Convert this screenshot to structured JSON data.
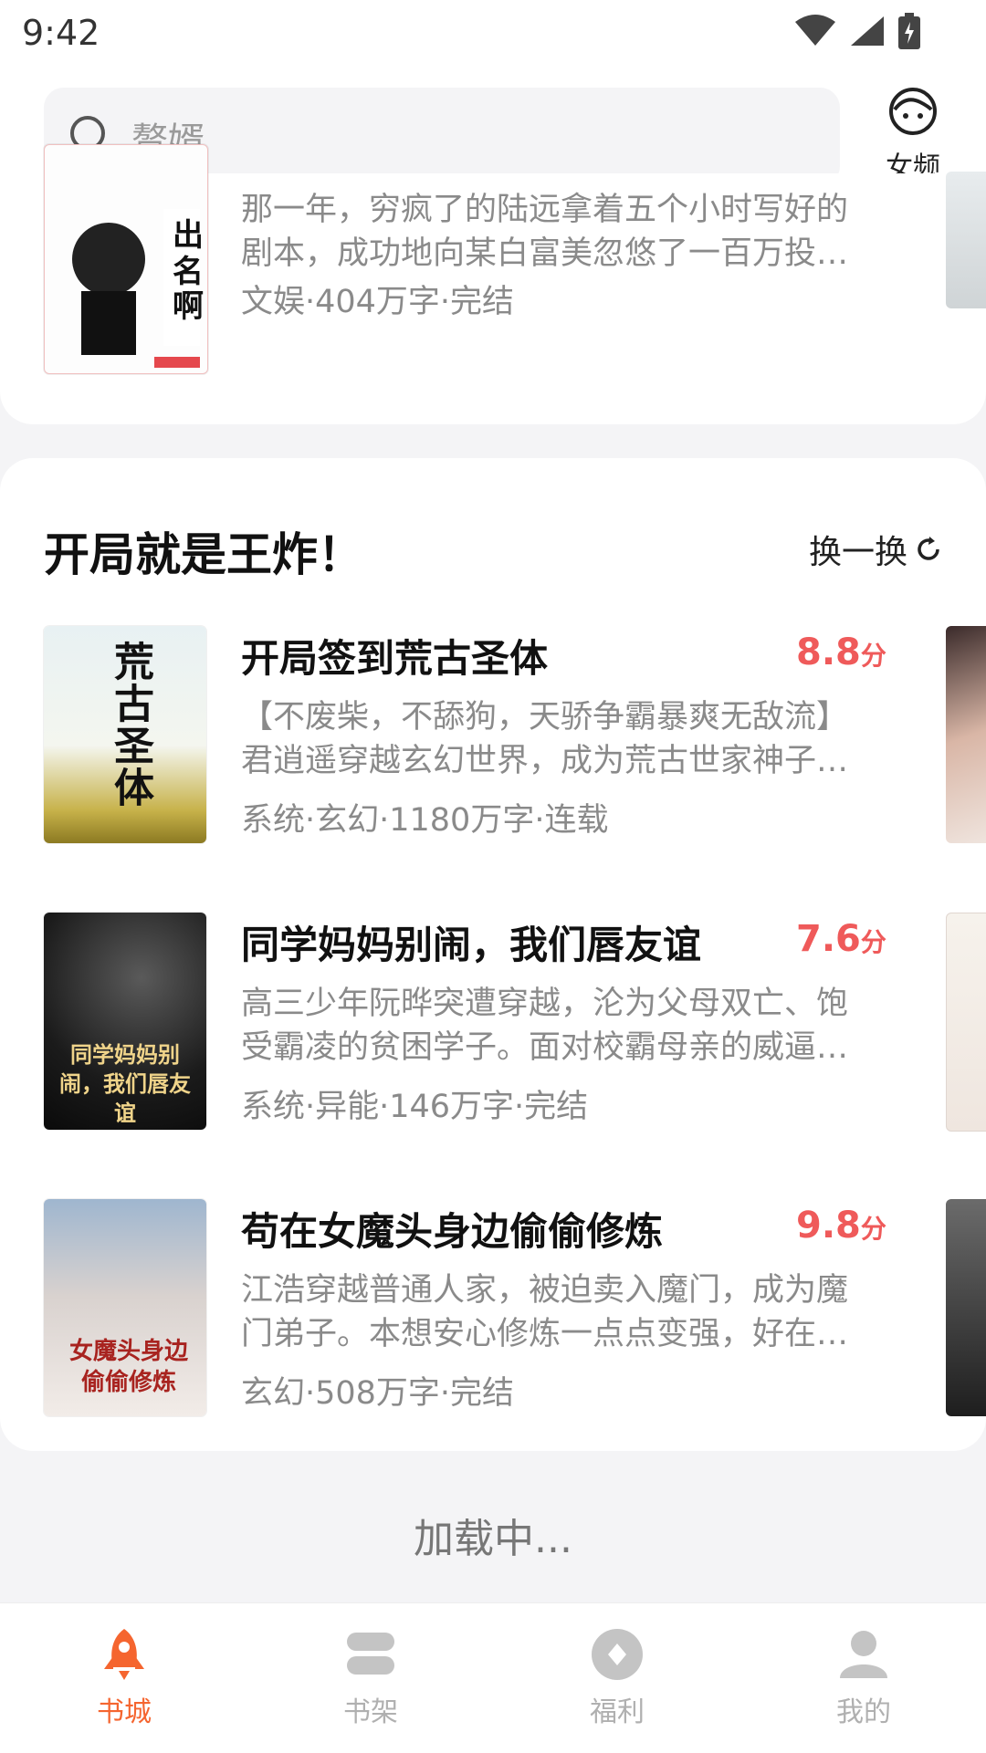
{
  "status": {
    "time": "9:42"
  },
  "search": {
    "placeholder": "赘婿"
  },
  "channel": {
    "label": "女频",
    "icon": "girl-face-icon"
  },
  "prev_book": {
    "desc": "那一年，穷疯了的陆远拿着五个小时写好的剧本，成功地向某白富美忽悠了一百万投…",
    "meta": "文娱·404万字·完结"
  },
  "section": {
    "title": "开局就是王炸！",
    "refresh": "换一换"
  },
  "books": [
    {
      "title": "开局签到荒古圣体",
      "score": "8.8",
      "unit": "分",
      "desc": "【不废柴，不舔狗，天骄争霸暴爽无敌流】君逍遥穿越玄幻世界，成为荒古世家神子…",
      "meta": "系统·玄幻·1180万字·连载",
      "cover_text": "荒古圣体"
    },
    {
      "title": "同学妈妈别闹，我们唇友谊",
      "score": "7.6",
      "unit": "分",
      "desc": "高三少年阮晔突遭穿越，沦为父母双亡、饱受霸凌的贫困学子。面对校霸母亲的威逼…",
      "meta": "系统·异能·146万字·完结",
      "cover_text": "同学妈妈别闹，我们唇友谊"
    },
    {
      "title": "苟在女魔头身边偷偷修炼",
      "score": "9.8",
      "unit": "分",
      "desc": "江浩穿越普通人家，被迫卖入魔门，成为魔门弟子。本想安心修炼一点点变强，好在…",
      "meta": "玄幻·508万字·完结",
      "cover_text": "女魔头身边偷偷修炼"
    }
  ],
  "loading": "加载中...",
  "nav": [
    {
      "label": "书城",
      "icon": "rocket-icon",
      "active": true
    },
    {
      "label": "书架",
      "icon": "bookshelf-icon",
      "active": false
    },
    {
      "label": "福利",
      "icon": "diamond-icon",
      "active": false
    },
    {
      "label": "我的",
      "icon": "person-icon",
      "active": false
    }
  ],
  "colors": {
    "accent": "#f5652f",
    "score": "#ef5a5a"
  }
}
